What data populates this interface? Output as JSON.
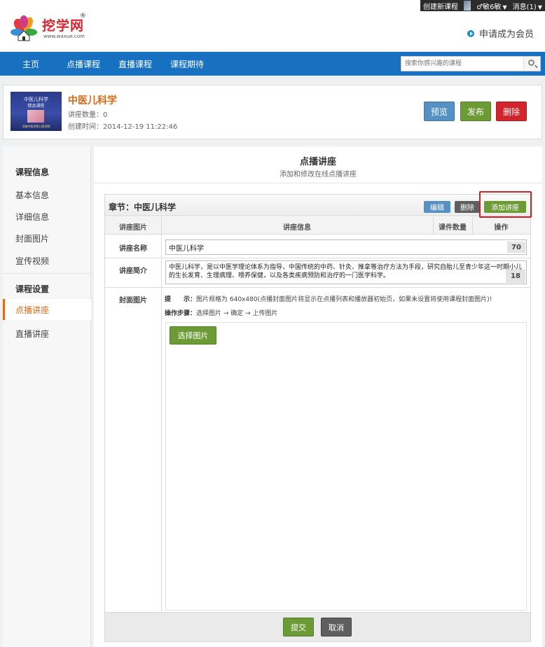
{
  "topbar": {
    "create_course": "创建新课程",
    "user_name": "♂敏6敏",
    "messages": "消息(1)"
  },
  "header": {
    "logo_text": "挖学网",
    "logo_reg": "®",
    "logo_url": "www.waxue.com",
    "become_member": "申请成为会员"
  },
  "nav": {
    "items": [
      "主页",
      "点播课程",
      "直播课程",
      "课程期待"
    ],
    "search_placeholder": "搜索你感兴趣的课程"
  },
  "course": {
    "thumb_line1": "中医儿科学",
    "thumb_line2": "精品课程",
    "thumb_line3": "河南中医学院儿科学院",
    "title": "中医儿科学",
    "lecture_count": "讲座数量：0",
    "created": "创建时间：2014-12-19 11:22:46",
    "btn_preview": "预览",
    "btn_publish": "发布",
    "btn_delete": "删除"
  },
  "sidebar": {
    "group1": "课程信息",
    "items1": [
      "基本信息",
      "详细信息",
      "封面图片",
      "宣传视频"
    ],
    "group2": "课程设置",
    "active": "点播讲座",
    "items2": [
      "直播讲座"
    ]
  },
  "main": {
    "title": "点播讲座",
    "subtitle": "添加和修改在线点播讲座",
    "chapter": "章节：中医儿科学",
    "btn_edit": "编辑",
    "btn_del": "删除",
    "btn_add": "添加讲座",
    "col_image": "讲座图片",
    "col_info": "讲座信息",
    "col_count": "课件数量",
    "col_action": "操作",
    "label_name": "讲座名称",
    "name_value": "中医儿科学",
    "name_remaining": "70",
    "label_intro": "讲座简介",
    "intro_value": "中医儿科学，是以中医学理论体系为指导，中国传统的中药、针灸、推拿等治疗方法为手段，研究自胎儿至青少年这一时期小儿的生长发育、生理病理、喂养保健，以及各类疾病预防和治疗的一门医学科学。",
    "intro_remaining": "18",
    "label_cover": "封面图片",
    "tip_label": "提　　示：",
    "tip_text": "图片规格为 640x480(点播封面图片将显示在点播列表和播放器初始页，如果未设置将使用课程封面图片)!",
    "steps_label": "操作步骤：",
    "steps_text": "选择图片 → 确定 → 上传图片",
    "btn_select": "选择图片",
    "btn_submit": "提交",
    "btn_cancel": "取消"
  },
  "colors": {
    "nav_blue": "#1870c0",
    "accent_orange": "#e06a1a",
    "green": "#6c9a35",
    "red": "#d1242b",
    "blue_btn": "#5591c2"
  }
}
